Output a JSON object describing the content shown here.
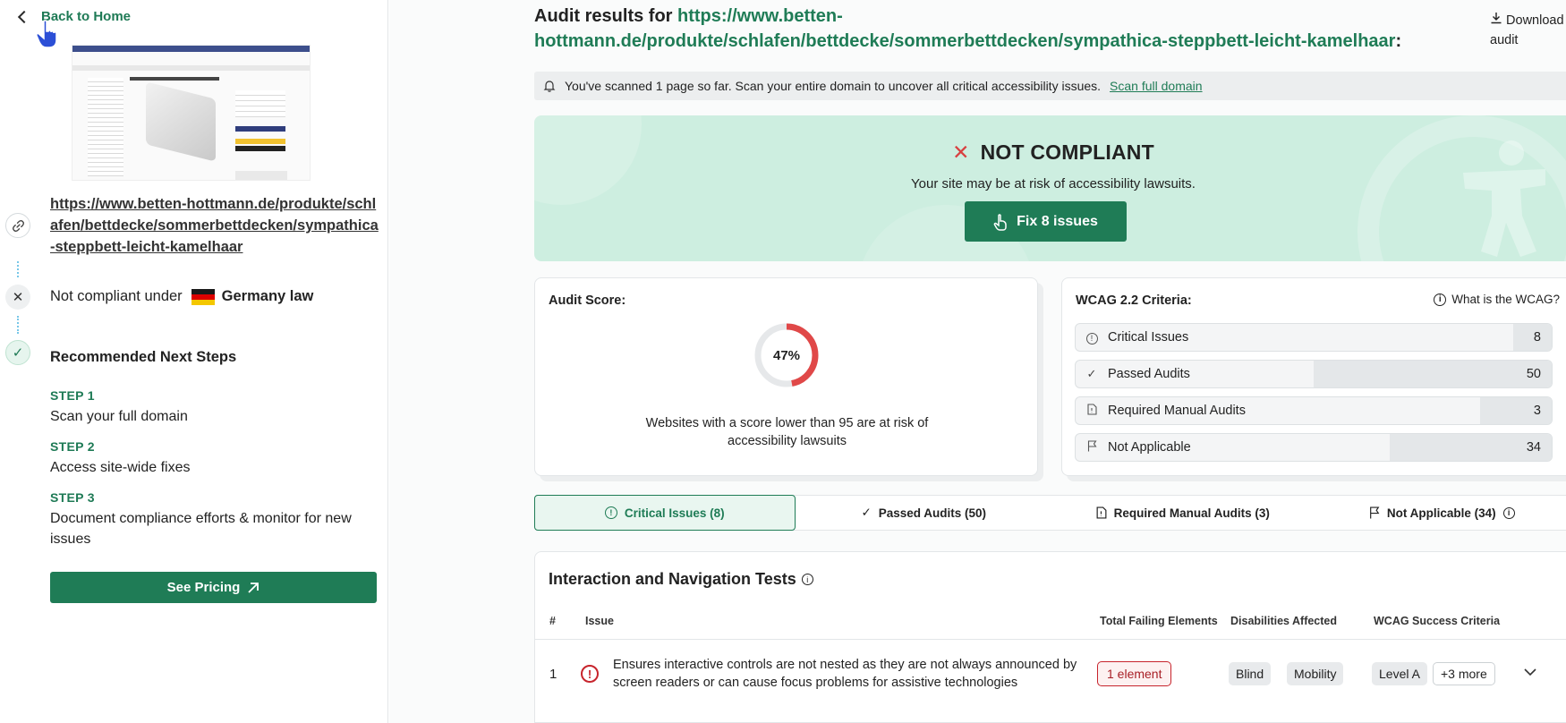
{
  "sidebar": {
    "back_label": "Back to Home",
    "page_url": "https://www.betten-hottmann.de/produkte/schlafen/bettdecke/sommerbettdecken/sympathica-steppbett-leicht-kamelhaar",
    "compliance_prefix": "Not compliant under",
    "compliance_law": "Germany law",
    "steps_title": "Recommended Next Steps",
    "steps": [
      {
        "label": "STEP 1",
        "text": "Scan your full domain"
      },
      {
        "label": "STEP 2",
        "text": "Access site-wide fixes"
      },
      {
        "label": "STEP 3",
        "text": "Document compliance efforts & monitor for new issues"
      }
    ],
    "pricing_button": "See Pricing"
  },
  "header": {
    "title_prefix": "Audit results for",
    "title_url": "https://www.betten-hottmann.de/produkte/schlafen/bettdecke/sommerbettdecken/sympathica-steppbett-leicht-kamelhaar",
    "title_suffix": ":",
    "download": "Download audit"
  },
  "banner": {
    "text": "You've scanned 1 page so far. Scan your entire domain to uncover all critical accessibility issues.",
    "link": "Scan full domain"
  },
  "hero": {
    "status": "NOT COMPLIANT",
    "subtitle": "Your site may be at risk of accessibility lawsuits.",
    "fix_button": "Fix 8 issues"
  },
  "score": {
    "label": "Audit Score:",
    "value": 47,
    "value_text": "47%",
    "note": "Websites with a score lower than 95 are at risk of accessibility lawsuits"
  },
  "wcag": {
    "label": "WCAG 2.2 Criteria:",
    "help": "What is the WCAG?",
    "rows": [
      {
        "name": "Critical Issues",
        "count": "8",
        "fill": 0.08,
        "icon": "alert-circle-icon"
      },
      {
        "name": "Passed Audits",
        "count": "50",
        "fill": 0.5,
        "icon": "check-icon"
      },
      {
        "name": "Required Manual Audits",
        "count": "3",
        "fill": 0.15,
        "icon": "document-icon"
      },
      {
        "name": "Not Applicable",
        "count": "34",
        "fill": 0.34,
        "icon": "flag-icon"
      }
    ]
  },
  "tabs": [
    {
      "label": "Critical Issues (8)",
      "icon": "alert-circle-icon",
      "active": true
    },
    {
      "label": "Passed Audits (50)",
      "icon": "check-icon",
      "active": false
    },
    {
      "label": "Required Manual Audits (3)",
      "icon": "document-icon",
      "active": false
    },
    {
      "label": "Not Applicable (34)",
      "icon": "flag-icon",
      "active": false
    }
  ],
  "table": {
    "title": "Interaction and Navigation Tests",
    "headers": [
      "#",
      "Issue",
      "Total Failing Elements",
      "Disabilities Affected",
      "WCAG Success Criteria"
    ],
    "rows": [
      {
        "num": "1",
        "issue": "Ensures interactive controls are not nested as they are not always announced by screen readers or can cause focus problems for assistive technologies",
        "failing": "1 element",
        "disabilities": [
          "Blind",
          "Mobility"
        ],
        "criteria": "Level A",
        "more": "+3 more"
      }
    ]
  },
  "colors": {
    "brand_green": "#1f7c56",
    "danger_red": "#d84040",
    "hero_bg": "#cdeee0"
  }
}
